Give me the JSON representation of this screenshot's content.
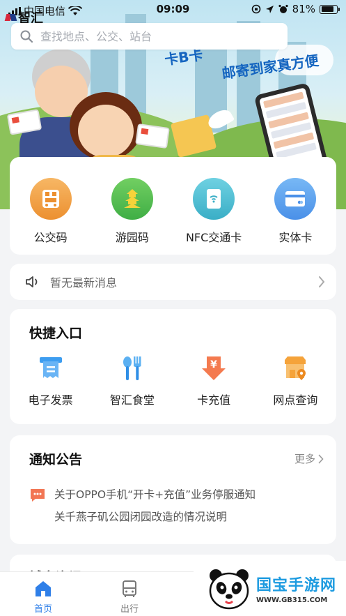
{
  "status_bar": {
    "carrier": "中国电信",
    "time": "09:09",
    "battery": "81%"
  },
  "app": {
    "logo_text": "智汇"
  },
  "banner": {
    "text_1": "卡B卡",
    "text_2": "邮寄到家真方便"
  },
  "search": {
    "placeholder": "查找地点、公交、站台"
  },
  "services": [
    {
      "label": "公交码",
      "color": "#f0a24a"
    },
    {
      "label": "游园码",
      "color": "#5fc05a"
    },
    {
      "label": "NFC交通卡",
      "color": "#55c0d6"
    },
    {
      "label": "实体卡",
      "color": "#5aa4ef"
    }
  ],
  "news": {
    "text": "暂无最新消息"
  },
  "quick": {
    "title": "快捷入口",
    "items": [
      {
        "label": "电子发票",
        "icon": "receipt-icon",
        "color": "#3d9df0"
      },
      {
        "label": "智汇食堂",
        "icon": "spoon-fork-icon",
        "color": "#2f8ee6"
      },
      {
        "label": "卡充值",
        "icon": "recharge-icon",
        "color": "#f06a3f"
      },
      {
        "label": "网点查询",
        "icon": "store-location-icon",
        "color": "#f5a33a"
      }
    ]
  },
  "notice": {
    "title": "通知公告",
    "more": "更多",
    "items": [
      "关于OPPO手机“开卡+充值”业务停服通知",
      "关千燕子矶公园闭园改造的情况说明"
    ]
  },
  "city": {
    "title": "城市资讯"
  },
  "tabbar": {
    "home": "首页",
    "travel": "出行",
    "active_color": "#2f7fe8"
  },
  "watermark": {
    "title": "国宝手游网",
    "url": "WWW.GB315.COM"
  }
}
